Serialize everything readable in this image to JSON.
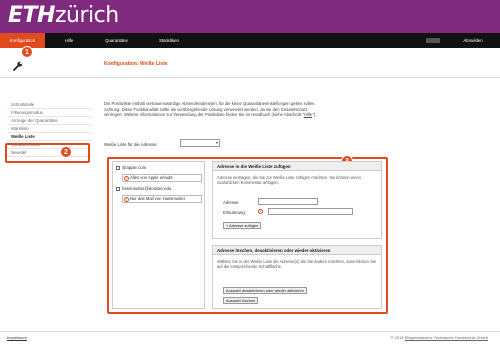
{
  "brand": {
    "logo_bold": "ETH",
    "logo_rest": "zürich"
  },
  "nav": {
    "items": [
      "Konfiguration",
      "Hilfe",
      "Quarantäne",
      "Statistiken"
    ],
    "logout": "Abmelden"
  },
  "annotations": {
    "one": "1",
    "two": "2",
    "three": "3"
  },
  "page": {
    "title": "Konfiguration: Weiße Liste"
  },
  "sidebar": {
    "items": [
      "Schnittstelle",
      "Filterungsmodus",
      "Anzeige der Quarantäne",
      "Warnliste",
      "Weiße Liste",
      "Schwarze Liste",
      "Newslet"
    ]
  },
  "intro": {
    "line1": "Die Positivliste enthält vertrauenswürdige Absenderadressen, für die keine Quarantäneeinstellungen gelten sollen.",
    "line2": "Achtung: Diese Funktionalität sollte als vorübergehende Lösung verwendet werden, da sie den Gesamtschutz",
    "line3": "verringert. Weitere Informationen zur Verwendung der Positivliste finden Sie im Handbuch (siehe Abschnitt \"",
    "link": "Hilfe",
    "line3_end": "\")."
  },
  "list_selector": {
    "label": "Weiße Liste für die Adresse:",
    "value": ""
  },
  "entries": [
    {
      "address": "@apple.com",
      "comment": "Alles von Apple erlaubt",
      "comment_icon": "i"
    },
    {
      "address": "hansmuster@domain.edu",
      "comment": "Nur das Mail von Hansmuster",
      "comment_icon": "i"
    }
  ],
  "add_panel": {
    "title": "Adresse in die Weiße Liste zufügen",
    "text": "Adresse eintragen, die Sie zur Weiße Liste zufügen möchten. Sie können einen zusätzlichen Kommentar anfügen.",
    "address_label": "Adresse:",
    "comment_label": "Erläuterung:",
    "comment_icon": "i",
    "button": "+ Adresse zufügen"
  },
  "manage_panel": {
    "title": "Adresse löschen, desaktivieren oder wieder-aktivieren",
    "text": "Wählen Sie in der Weiße Liste die Adresse(n) die Sie ändern möchten, dann klicken Sie auf die entsprechende Schaltfläche.",
    "button1": "Auswahl desaktivieren oder wieder aktivieren",
    "button2": "Auswahl löschen"
  },
  "footer": {
    "imprint": "Impressum",
    "copyright_prefix": "© 2018",
    "copyright_link": "Eidgenössische Technische Hochschule Zürich"
  },
  "colors": {
    "brand": "#7f2a7f",
    "accent": "#e04a1c",
    "navbar": "#111111"
  }
}
